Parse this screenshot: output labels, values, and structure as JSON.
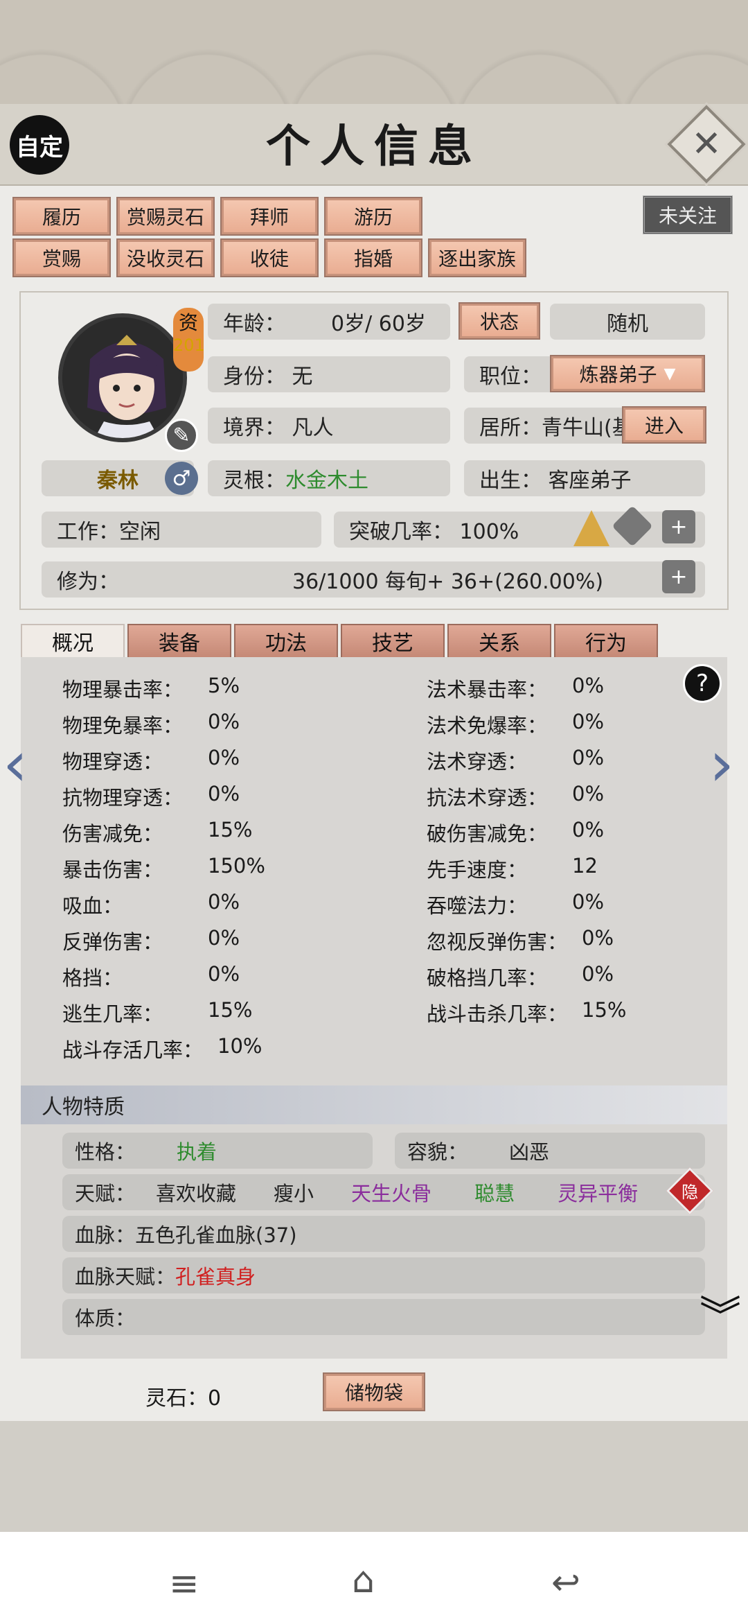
{
  "header": {
    "title": "个人信息",
    "custom_label": "自定",
    "follow_label": "未关注"
  },
  "toolbar_row1": [
    "履历",
    "赏赐灵石",
    "拜师",
    "游历"
  ],
  "toolbar_row2": [
    "赏赐",
    "没收灵石",
    "收徒",
    "指婚",
    "逐出家族"
  ],
  "character": {
    "name": "秦林",
    "aptitude_label": "资",
    "aptitude_value": "201",
    "age_label": "年龄：",
    "age_value": "0岁/ 60岁",
    "status_btn": "状态",
    "random_btn": "随机",
    "identity": "身份：  无",
    "position_label": "职位：",
    "position_value": "炼器弟子",
    "realm": "境界：  凡人",
    "residence": "居所：青牛山(基",
    "enter_btn": "进入",
    "root_label": "灵根：",
    "root_value": "水金木土",
    "birth": "出生：  客座弟子",
    "work": "工作：空闲",
    "breakthrough": "突破几率：  100%",
    "cultivation_label": "修为：",
    "cultivation_value": "36/1000  每旬+  36+(260.00%)",
    "break_icon_text": "突破"
  },
  "tabs": [
    "概况",
    "装备",
    "功法",
    "技艺",
    "关系",
    "行为"
  ],
  "stats_left": [
    [
      "物理暴击率：",
      "5%"
    ],
    [
      "物理免暴率：",
      "0%"
    ],
    [
      "物理穿透：",
      "0%"
    ],
    [
      "抗物理穿透：",
      "0%"
    ],
    [
      "伤害减免：",
      "15%"
    ],
    [
      "暴击伤害：",
      "150%"
    ],
    [
      "吸血：",
      "0%"
    ],
    [
      "反弹伤害：",
      "0%"
    ],
    [
      "格挡：",
      "0%"
    ],
    [
      "逃生几率：",
      "15%"
    ],
    [
      "战斗存活几率：",
      "10%"
    ]
  ],
  "stats_right": [
    [
      "法术暴击率：",
      "0%"
    ],
    [
      "法术免爆率：",
      "0%"
    ],
    [
      "法术穿透：",
      "0%"
    ],
    [
      "抗法术穿透：",
      "0%"
    ],
    [
      "破伤害减免：",
      "0%"
    ],
    [
      "先手速度：",
      "12"
    ],
    [
      "吞噬法力：",
      "0%"
    ],
    [
      "忽视反弹伤害：",
      "0%"
    ],
    [
      "破格挡几率：",
      "0%"
    ],
    [
      "战斗击杀几率：",
      "15%"
    ]
  ],
  "traits": {
    "section_title": "人物特质",
    "personality_label": "性格：",
    "personality_value": "执着",
    "appearance_label": "容貌：",
    "appearance_value": "凶恶",
    "talent_label": "天赋：",
    "talents": [
      "喜欢收藏",
      "瘦小",
      "天生火骨",
      "聪慧",
      "灵异平衡"
    ],
    "hide_label": "隐",
    "bloodline_label": "血脉：",
    "bloodline_value": "五色孔雀血脉(37)",
    "bloodline_talent_label": "血脉天赋：",
    "bloodline_talent_value": "孔雀真身",
    "physique_label": "体质："
  },
  "footer": {
    "spirit_stone": "灵石：0",
    "bag_btn": "储物袋"
  }
}
